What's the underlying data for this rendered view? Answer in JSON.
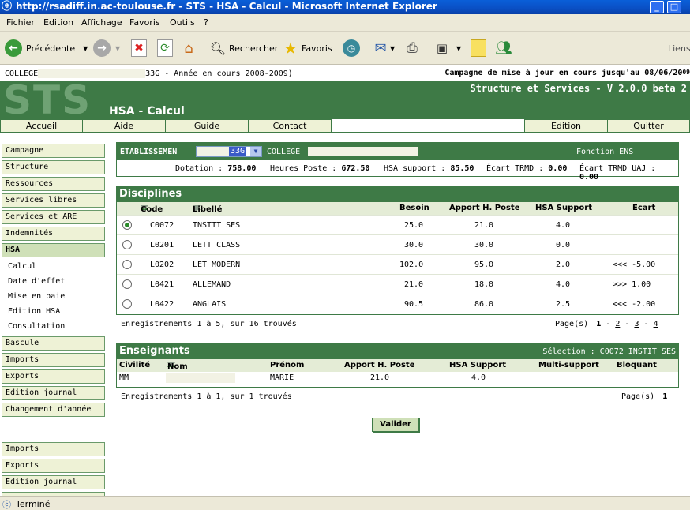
{
  "window": {
    "title": "http://rsadiff.in.ac-toulouse.fr - STS - HSA - Calcul - Microsoft Internet Explorer"
  },
  "menu": [
    "Fichier",
    "Edition",
    "Affichage",
    "Favoris",
    "Outils",
    "?"
  ],
  "toolbar": {
    "back_label": "Précédente",
    "search_label": "Rechercher",
    "favorites_label": "Favoris",
    "links_label": "Liens"
  },
  "info": {
    "left_prefix": "COLLEGE",
    "left_suffix": "33G - Année en cours 2008-2009)",
    "right": "Campagne de mise à jour en cours jusqu'au 08/06/20",
    "right_tail": "09"
  },
  "banner": {
    "logo": "STS",
    "module": "HSA - Calcul",
    "version": "Structure et Services - V 2.0.0 beta 2"
  },
  "nav": {
    "accueil": "Accueil",
    "aide": "Aide",
    "guide": "Guide",
    "contact": "Contact",
    "edition": "Edition",
    "quitter": "Quitter"
  },
  "sidebar": {
    "items": [
      "Campagne",
      "Structure",
      "Ressources",
      "Services libres",
      "Services et ARE",
      "Indemnités",
      "HSA"
    ],
    "hsa_sub": [
      "Calcul",
      "Date d'effet",
      "Mise en paie",
      "Edition HSA",
      "Consultation"
    ],
    "items2": [
      "Bascule",
      "Imports",
      "Exports",
      "Edition journal",
      "Changement d'année"
    ],
    "items3": [
      "Imports",
      "Exports",
      "Edition journal"
    ]
  },
  "etab": {
    "label": "ETABLISSEMEN",
    "select_value": "33G",
    "college_label": "COLLEGE",
    "fonction": "Fonction ENS",
    "dotation_label": "Dotation :",
    "dotation": "758.00",
    "heures_label": "Heures Poste :",
    "heures": "672.50",
    "hsa_label": "HSA support :",
    "hsa": "85.50",
    "ecart_label": "Écart TRMD :",
    "ecart": "0.00",
    "ecart_uaj_label": "Écart TRMD UAJ :",
    "ecart_uaj": "0.00"
  },
  "disciplines": {
    "title": "Disciplines",
    "columns": {
      "code": "Code",
      "libelle": "Libellé",
      "besoin": "Besoin",
      "apport": "Apport H. Poste",
      "hsa": "HSA Support",
      "ecart": "Ecart"
    },
    "rows": [
      {
        "code": "C0072",
        "libelle": "INSTIT SES",
        "besoin": "25.0",
        "apport": "21.0",
        "hsa": "4.0",
        "ecart": ""
      },
      {
        "code": "L0201",
        "libelle": "LETT CLASS",
        "besoin": "30.0",
        "apport": "30.0",
        "hsa": "0.0",
        "ecart": ""
      },
      {
        "code": "L0202",
        "libelle": "LET MODERN",
        "besoin": "102.0",
        "apport": "95.0",
        "hsa": "2.0",
        "ecart": "<<< -5.00"
      },
      {
        "code": "L0421",
        "libelle": "ALLEMAND",
        "besoin": "21.0",
        "apport": "18.0",
        "hsa": "4.0",
        "ecart": ">>> 1.00"
      },
      {
        "code": "L0422",
        "libelle": "ANGLAIS",
        "besoin": "90.5",
        "apport": "86.0",
        "hsa": "2.5",
        "ecart": "<<< -2.00"
      }
    ],
    "selected_index": 0,
    "count_text": "Enregistrements 1 à 5, sur 16 trouvés",
    "pages_label": "Page(s)",
    "pages": [
      "1",
      "2",
      "3",
      "4"
    ],
    "sep": "-"
  },
  "enseignants": {
    "title": "Enseignants",
    "selection": "Sélection : C0072 INSTIT SES",
    "columns": {
      "civilite": "Civilité",
      "nom": "Nom",
      "prenom": "Prénom",
      "apport": "Apport H. Poste",
      "hsa": "HSA Support",
      "multi": "Multi-support",
      "bloquant": "Bloquant"
    },
    "rows": [
      {
        "civilite": "MM",
        "prenom": "MARIE",
        "apport": "21.0",
        "hsa": "4.0"
      }
    ],
    "count_text": "Enregistrements 1 à 1, sur 1 trouvés",
    "pages_label": "Page(s)",
    "page": "1"
  },
  "valider_label": "Valider",
  "status": "Terminé",
  "colors": {
    "green_dark": "#3e7a46",
    "green_light": "#eef2d6",
    "xp_blue": "#0a4fc4"
  },
  "icons": [
    "ie-icon",
    "back-arrow-icon",
    "forward-arrow-icon",
    "stop-icon",
    "refresh-icon",
    "home-icon",
    "search-icon",
    "favorites-star-icon",
    "history-icon",
    "mail-icon",
    "print-icon",
    "edit-icon",
    "messenger-icon",
    "sort-up-icon",
    "sort-down-icon",
    "radio-icon",
    "select-arrow-icon"
  ]
}
